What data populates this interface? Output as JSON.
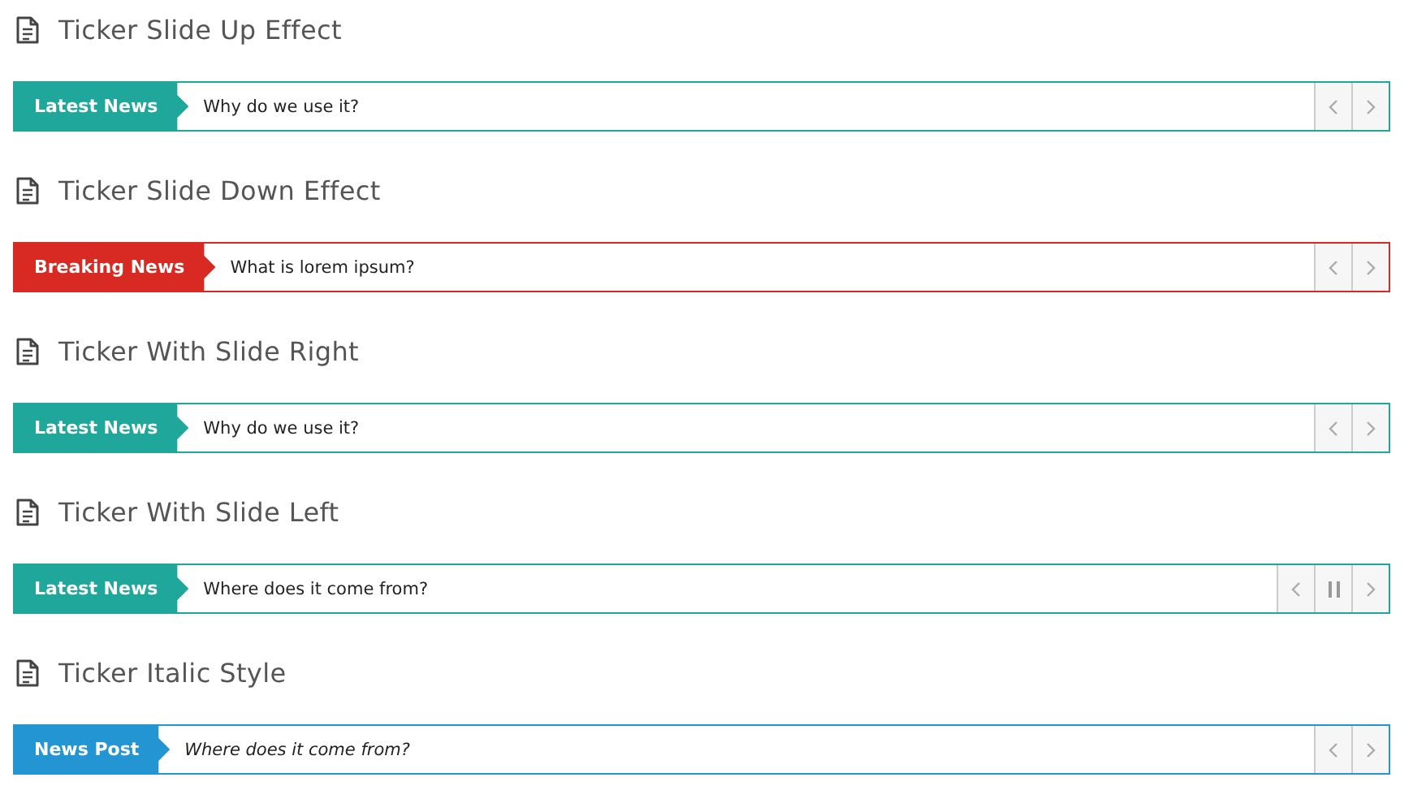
{
  "sections": [
    {
      "title": "Ticker Slide Up Effect",
      "ticker": {
        "label": "Latest News",
        "color": "#1fa79b",
        "headline": "Why do we use it?",
        "italic": false,
        "controls": [
          {
            "kind": "prev"
          },
          {
            "kind": "next"
          }
        ]
      }
    },
    {
      "title": "Ticker Slide Down Effect",
      "ticker": {
        "label": "Breaking News",
        "color": "#d82a22",
        "headline": "What is lorem ipsum?",
        "italic": false,
        "controls": [
          {
            "kind": "prev"
          },
          {
            "kind": "next"
          }
        ]
      }
    },
    {
      "title": "Ticker With Slide Right",
      "ticker": {
        "label": "Latest News",
        "color": "#1fa79b",
        "headline": "Why do we use it?",
        "italic": false,
        "controls": [
          {
            "kind": "prev"
          },
          {
            "kind": "next"
          }
        ]
      }
    },
    {
      "title": "Ticker With Slide Left",
      "ticker": {
        "label": "Latest News",
        "color": "#1fa79b",
        "headline": "Where does it come from?",
        "italic": false,
        "controls": [
          {
            "kind": "prev"
          },
          {
            "kind": "pause"
          },
          {
            "kind": "next"
          }
        ]
      }
    },
    {
      "title": "Ticker Italic Style",
      "ticker": {
        "label": "News Post",
        "color": "#2495d3",
        "headline": "Where does it come from?",
        "italic": true,
        "controls": [
          {
            "kind": "prev"
          },
          {
            "kind": "next"
          }
        ]
      }
    }
  ]
}
